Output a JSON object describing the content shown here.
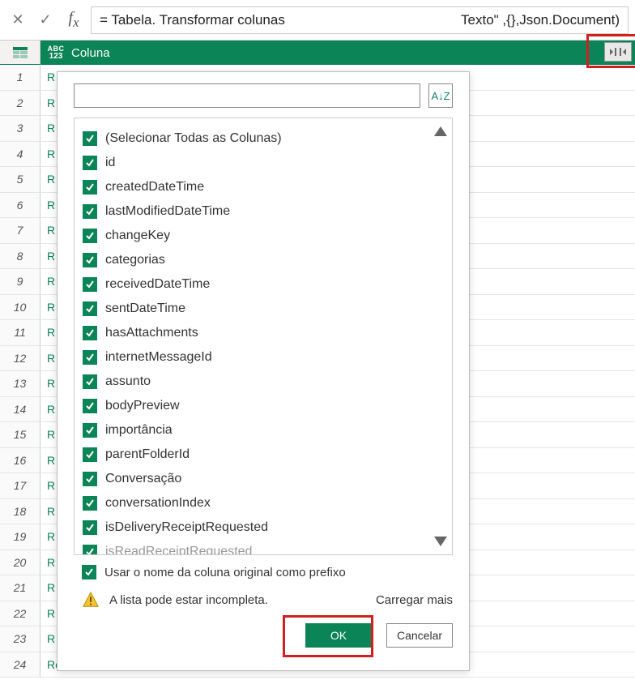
{
  "formula": {
    "left": "=  Tabela. Transformar colunas",
    "right": "Texto\" ,{},Json.Document)"
  },
  "column": {
    "type_label_top": "ABC",
    "type_label_bottom": "123",
    "name": "Coluna"
  },
  "rows": {
    "count": 24,
    "cell_value": "R",
    "last_cell_value": "Record"
  },
  "dropdown": {
    "sort_label": "A↓Z",
    "items": [
      "(Selecionar Todas as Colunas)",
      "id",
      "createdDateTime",
      "lastModifiedDateTime",
      "changeKey",
      "categorias",
      "receivedDateTime",
      "sentDateTime",
      "hasAttachments",
      "internetMessageId",
      "assunto",
      "bodyPreview",
      "importância",
      "parentFolderId",
      "Conversação",
      "conversationIndex",
      "isDeliveryReceiptRequested",
      "isReadReceiptRequested"
    ],
    "prefix_label": "Usar o nome da coluna original como prefixo",
    "warning_text": "A lista pode estar incompleta.",
    "load_more": "Carregar mais",
    "ok_label": "OK",
    "cancel_label": "Cancelar"
  }
}
